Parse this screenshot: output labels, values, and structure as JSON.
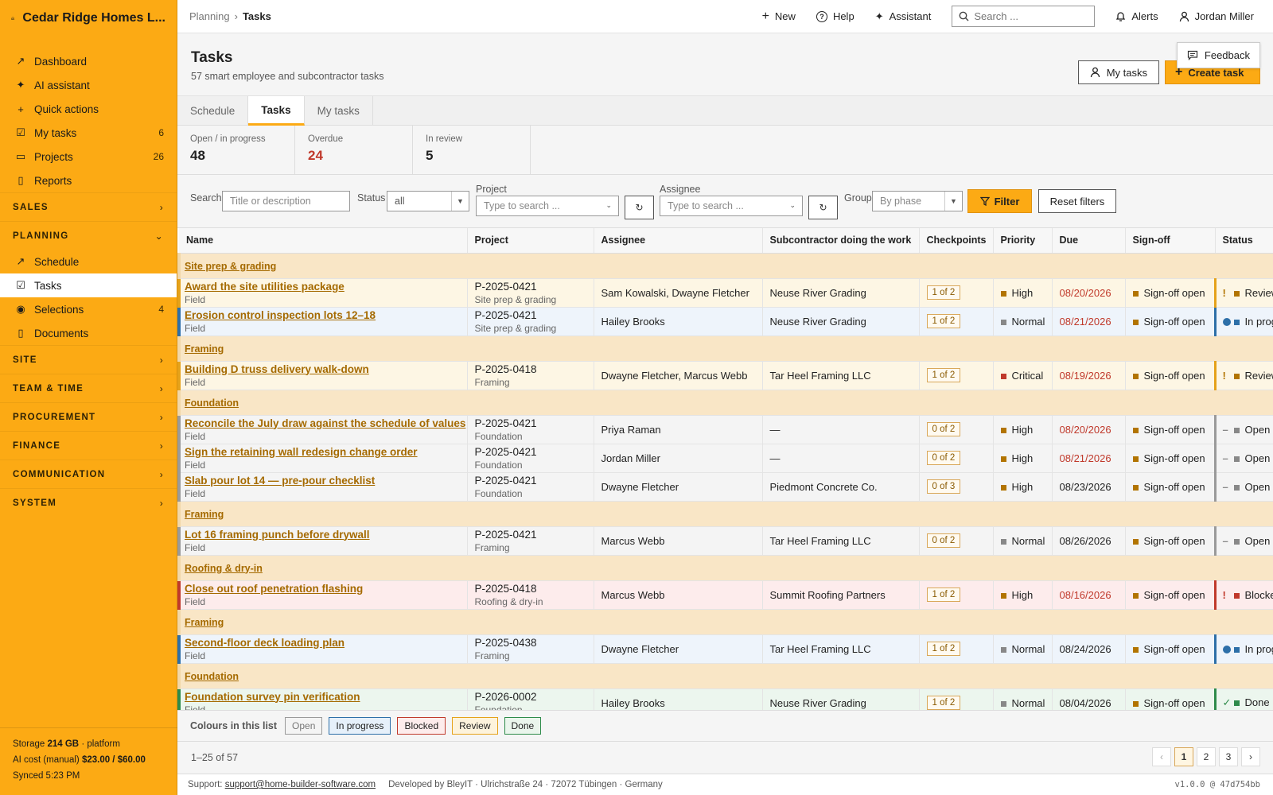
{
  "app": {
    "brand": "Cedar Ridge Homes L..."
  },
  "sidebar": {
    "top_items": [
      {
        "label": "Dashboard",
        "icon": "chart-line-icon",
        "glyph": "↗",
        "count": ""
      },
      {
        "label": "AI assistant",
        "icon": "sparkle-icon",
        "glyph": "✦",
        "count": ""
      },
      {
        "label": "Quick actions",
        "icon": "plus-icon",
        "glyph": "+",
        "count": ""
      },
      {
        "label": "My tasks",
        "icon": "checkbox-icon",
        "glyph": "☑",
        "count": "6"
      },
      {
        "label": "Projects",
        "icon": "folder-icon",
        "glyph": "▭",
        "count": "26"
      },
      {
        "label": "Reports",
        "icon": "document-icon",
        "glyph": "▯",
        "count": ""
      }
    ],
    "sections": {
      "sales": "SALES",
      "planning": "PLANNING",
      "site": "SITE",
      "team_time": "TEAM & TIME",
      "procurement": "PROCUREMENT",
      "finance": "FINANCE",
      "communication": "COMMUNICATION",
      "system": "SYSTEM"
    },
    "planning_items": [
      {
        "label": "Schedule",
        "icon": "chart-line-icon",
        "glyph": "↗",
        "count": ""
      },
      {
        "label": "Tasks",
        "icon": "checkbox-icon",
        "glyph": "☑",
        "count": ""
      },
      {
        "label": "Selections",
        "icon": "eye-icon",
        "glyph": "◉",
        "count": "4"
      },
      {
        "label": "Documents",
        "icon": "document-icon",
        "glyph": "▯",
        "count": ""
      }
    ],
    "footer": {
      "storage_label": "Storage",
      "storage_value": "214 GB",
      "storage_suffix": "· platform",
      "ai_cost_label": "AI cost (manual)",
      "ai_cost_value": "$23.00 / $60.00",
      "synced": "Synced 5:23 PM"
    }
  },
  "topbar": {
    "breadcrumb_parent": "Planning",
    "breadcrumb_sep": "›",
    "breadcrumb_current": "Tasks",
    "new": "New",
    "help": "Help",
    "assistant": "Assistant",
    "search_placeholder": "Search ...",
    "alerts": "Alerts",
    "user": "Jordan Miller"
  },
  "page": {
    "title": "Tasks",
    "subtitle": "57 smart employee and subcontractor tasks",
    "my_tasks_button": "My tasks",
    "create_button": "Create task",
    "feedback_button": "Feedback"
  },
  "tabs": [
    "Schedule",
    "Tasks",
    "My tasks"
  ],
  "stats": [
    {
      "label": "Open / in progress",
      "value": "48",
      "red": false
    },
    {
      "label": "Overdue",
      "value": "24",
      "red": true
    },
    {
      "label": "In review",
      "value": "5",
      "red": false
    }
  ],
  "filters": {
    "search_label": "Search",
    "search_placeholder": "Title or description",
    "status_label": "Status",
    "status_value": "all",
    "project_label": "Project",
    "project_placeholder": "Type to search ...",
    "assignee_label": "Assignee",
    "assignee_placeholder": "Type to search ...",
    "group_label": "Group",
    "group_value": "By phase",
    "filter_button": "Filter",
    "reset_button": "Reset filters"
  },
  "table": {
    "columns": [
      "Name",
      "Project",
      "Assignee",
      "Subcontractor doing the work",
      "Checkpoints",
      "Priority",
      "Due",
      "Sign-off",
      "Status"
    ],
    "rows": [
      {
        "type": "group",
        "label": "Site prep & grading"
      },
      {
        "type": "task",
        "title": "Award the site utilities package",
        "kind": "Field",
        "project": "P-2025-0421",
        "phase": "Site prep & grading",
        "assignee": "Sam Kowalski, Dwayne Fletcher",
        "sub": "Neuse River Grading",
        "checkpoints": "1 of 2",
        "priority": "High",
        "due": "08/20/2026",
        "overdue": true,
        "signoff": "Sign-off open",
        "status": "Review",
        "status_mark": "!"
      },
      {
        "type": "task",
        "title": "Erosion control inspection lots 12–18",
        "kind": "Field",
        "project": "P-2025-0421",
        "phase": "Site prep & grading",
        "assignee": "Hailey Brooks",
        "sub": "Neuse River Grading",
        "checkpoints": "1 of 2",
        "priority": "Normal",
        "due": "08/21/2026",
        "overdue": true,
        "signoff": "Sign-off open",
        "status": "In progress",
        "status_mark": "●"
      },
      {
        "type": "group",
        "label": "Framing"
      },
      {
        "type": "task",
        "title": "Building D truss delivery walk-down",
        "kind": "Field",
        "project": "P-2025-0418",
        "phase": "Framing",
        "assignee": "Dwayne Fletcher, Marcus Webb",
        "sub": "Tar Heel Framing LLC",
        "checkpoints": "1 of 2",
        "priority": "Critical",
        "due": "08/19/2026",
        "overdue": true,
        "signoff": "Sign-off open",
        "status": "Review",
        "status_mark": "!"
      },
      {
        "type": "group",
        "label": "Foundation"
      },
      {
        "type": "task",
        "title": "Reconcile the July draw against the schedule of values",
        "kind": "Field",
        "project": "P-2025-0421",
        "phase": "Foundation",
        "assignee": "Priya Raman",
        "sub": "—",
        "checkpoints": "0 of 2",
        "priority": "High",
        "due": "08/20/2026",
        "overdue": true,
        "signoff": "Sign-off open",
        "status": "Open",
        "status_mark": "–"
      },
      {
        "type": "task",
        "title": "Sign the retaining wall redesign change order",
        "kind": "Field",
        "project": "P-2025-0421",
        "phase": "Foundation",
        "assignee": "Jordan Miller",
        "sub": "—",
        "checkpoints": "0 of 2",
        "priority": "High",
        "due": "08/21/2026",
        "overdue": true,
        "signoff": "Sign-off open",
        "status": "Open",
        "status_mark": "–"
      },
      {
        "type": "task",
        "title": "Slab pour lot 14 — pre-pour checklist",
        "kind": "Field",
        "project": "P-2025-0421",
        "phase": "Foundation",
        "assignee": "Dwayne Fletcher",
        "sub": "Piedmont Concrete Co.",
        "checkpoints": "0 of 3",
        "priority": "High",
        "due": "08/23/2026",
        "overdue": false,
        "signoff": "Sign-off open",
        "status": "Open",
        "status_mark": "–"
      },
      {
        "type": "group",
        "label": "Framing"
      },
      {
        "type": "task",
        "title": "Lot 16 framing punch before drywall",
        "kind": "Field",
        "project": "P-2025-0421",
        "phase": "Framing",
        "assignee": "Marcus Webb",
        "sub": "Tar Heel Framing LLC",
        "checkpoints": "0 of 2",
        "priority": "Normal",
        "due": "08/26/2026",
        "overdue": false,
        "signoff": "Sign-off open",
        "status": "Open",
        "status_mark": "–"
      },
      {
        "type": "group",
        "label": "Roofing & dry-in"
      },
      {
        "type": "task",
        "title": "Close out roof penetration flashing",
        "kind": "Field",
        "project": "P-2025-0418",
        "phase": "Roofing & dry-in",
        "assignee": "Marcus Webb",
        "sub": "Summit Roofing Partners",
        "checkpoints": "1 of 2",
        "priority": "High",
        "due": "08/16/2026",
        "overdue": true,
        "signoff": "Sign-off open",
        "status": "Blocked",
        "status_mark": "!"
      },
      {
        "type": "group",
        "label": "Framing"
      },
      {
        "type": "task",
        "title": "Second-floor deck loading plan",
        "kind": "Field",
        "project": "P-2025-0438",
        "phase": "Framing",
        "assignee": "Dwayne Fletcher",
        "sub": "Tar Heel Framing LLC",
        "checkpoints": "1 of 2",
        "priority": "Normal",
        "due": "08/24/2026",
        "overdue": false,
        "signoff": "Sign-off open",
        "status": "In progress",
        "status_mark": "●"
      },
      {
        "type": "group",
        "label": "Foundation"
      },
      {
        "type": "task",
        "title": "Foundation survey pin verification",
        "kind": "Field",
        "project": "P-2026-0002",
        "phase": "Foundation",
        "assignee": "Hailey Brooks",
        "sub": "Neuse River Grading",
        "checkpoints": "1 of 2",
        "priority": "Normal",
        "due": "08/04/2026",
        "overdue": false,
        "signoff": "Sign-off open",
        "status": "Done",
        "status_mark": "✓"
      }
    ]
  },
  "status_styles": {
    "Open": {
      "row_bg": "#f4f4f4",
      "border": "#9a9a9a",
      "chip_bg": "#f4f4f4",
      "mark_color": "#888",
      "sq": "#888"
    },
    "In progress": {
      "row_bg": "#eef4fb",
      "border": "#2d6fa8",
      "chip_bg": "#e6f0fa",
      "mark_color": "#2d6fa8",
      "sq": "#2d6fa8"
    },
    "Blocked": {
      "row_bg": "#fdecec",
      "border": "#c0392b",
      "chip_bg": "#fdecec",
      "mark_color": "#c0392b",
      "sq": "#c0392b"
    },
    "Review": {
      "row_bg": "#fdf6e4",
      "border": "#e5a21a",
      "chip_bg": "#fdf3dc",
      "mark_color": "#b27400",
      "sq": "#b27400"
    },
    "Done": {
      "row_bg": "#ecf6ee",
      "border": "#2e8b4a",
      "chip_bg": "#eaf5ec",
      "mark_color": "#2e8b4a",
      "sq": "#2e8b4a"
    }
  },
  "priority_colors": {
    "High": "#b27400",
    "Normal": "#888888",
    "Critical": "#c0392b"
  },
  "legend": {
    "label": "Colours in this list",
    "items": [
      "Open",
      "In progress",
      "Blocked",
      "Review",
      "Done"
    ]
  },
  "pagination": {
    "range": "1–25 of 57",
    "prev": "‹",
    "pages": [
      "1",
      "2",
      "3"
    ],
    "current": "1",
    "next": "›"
  },
  "footer": {
    "support_label": "Support:",
    "support_email": "support@home-builder-software.com",
    "developer": "Developed by BleyIT · Ulrichstraße 24 · 72072 Tübingen · Germany",
    "version": "v1.0.0 @ 47d754bb"
  }
}
